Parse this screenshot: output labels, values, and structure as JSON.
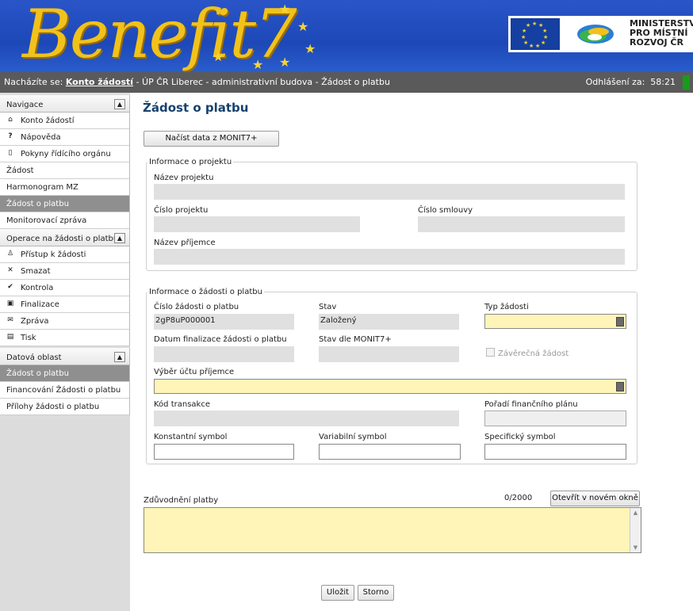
{
  "header": {
    "logo_text": "Benefit7",
    "ministry_line1": "MINISTERSTVO",
    "ministry_line2": "PRO MÍSTNÍ",
    "ministry_line3": "ROZVOJ ČR"
  },
  "infobar": {
    "location_prefix": "Nacházíte se:",
    "location_link": "Konto žádostí",
    "location_rest": "- ÚP ČR Liberec - administrativní budova - Žádost o platbu",
    "logout_label": "Odhlášení za:",
    "logout_time": "58:21"
  },
  "sidebar": {
    "nav_title": "Navigace",
    "nav_items": [
      {
        "label": "Konto žádostí",
        "icon": "home-icon"
      },
      {
        "label": "Nápověda",
        "icon": "help-icon"
      },
      {
        "label": "Pokyny řídícího orgánu",
        "icon": "book-icon"
      }
    ],
    "plain_items": [
      "Žádost",
      "Harmonogram MZ",
      "Žádost o platbu",
      "Monitorovací zpráva"
    ],
    "ops_title": "Operace na žádosti o platbu",
    "ops_items": [
      {
        "label": "Přístup k žádosti",
        "icon": "user-icon"
      },
      {
        "label": "Smazat",
        "icon": "delete-icon"
      },
      {
        "label": "Kontrola",
        "icon": "check-icon"
      },
      {
        "label": "Finalizace",
        "icon": "lock-icon"
      },
      {
        "label": "Zpráva",
        "icon": "mail-icon"
      },
      {
        "label": "Tisk",
        "icon": "print-icon"
      }
    ],
    "data_title": "Datová oblast",
    "data_items": [
      "Žádost o platbu",
      "Financování Žádosti o platbu",
      "Přílohy žádosti o platbu"
    ]
  },
  "main": {
    "title": "Žádost o platbu",
    "load_button": "Načíst data z MONIT7+",
    "project_group": {
      "legend": "Informace o projektu",
      "project_name_label": "Název projektu",
      "project_number_label": "Číslo projektu",
      "contract_number_label": "Číslo smlouvy",
      "recipient_name_label": "Název příjemce"
    },
    "request_group": {
      "legend": "Informace o žádosti o platbu",
      "request_number_label": "Číslo žádosti o platbu",
      "request_number_value": "2gP8uP000001",
      "status_label": "Stav",
      "status_value": "Založený",
      "type_label": "Typ žádosti",
      "finalization_date_label": "Datum finalizace žádosti o platbu",
      "monit_status_label": "Stav dle MONIT7+",
      "final_request_label": "Závěrečná žádost",
      "account_label": "Výběr účtu příjemce",
      "transaction_code_label": "Kód transakce",
      "financial_plan_label": "Pořadí finančního plánu",
      "constant_symbol_label": "Konstantní symbol",
      "variable_symbol_label": "Variabilní symbol",
      "specific_symbol_label": "Specifický symbol"
    },
    "justification_label": "Zdůvodnění platby",
    "char_counter": "0/2000",
    "open_window_button": "Otevřít v novém okně",
    "save_button": "Uložit",
    "cancel_button": "Storno"
  }
}
